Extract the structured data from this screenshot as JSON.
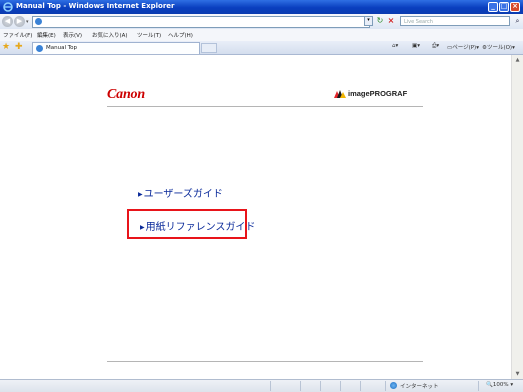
{
  "window": {
    "title": "Manual Top - Windows Internet Explorer"
  },
  "address_bar": {
    "url": "",
    "search_placeholder": "Live Search"
  },
  "menu": {
    "items": [
      "ファイル(F)",
      "編集(E)",
      "表示(V)",
      "お気に入り(A)",
      "ツール(T)",
      "ヘルプ(H)"
    ]
  },
  "tabs": {
    "active_label": "Manual Top"
  },
  "command_bar": {
    "page_label": "ページ(P)",
    "tools_label": "ツール(O)"
  },
  "page": {
    "brand": "Canon",
    "product_logo": "imagePROGRAF",
    "links": {
      "user_guide": "ユーザーズガイド",
      "paper_reference": "用紙リファレンスガイド"
    },
    "highlight_color": "#e8141a",
    "link_color": "#0a2a9a",
    "brand_color": "#cc0000"
  },
  "status_bar": {
    "zone": "インターネット",
    "zoom": "100%"
  }
}
